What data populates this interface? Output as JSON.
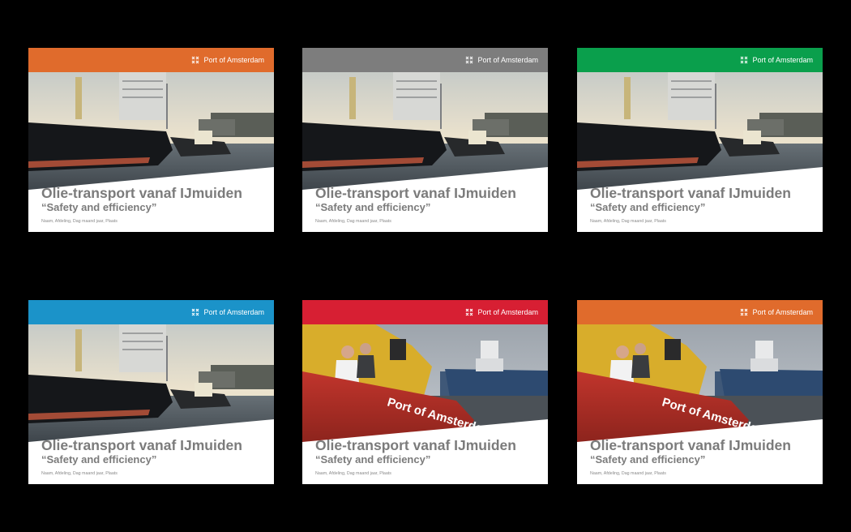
{
  "brand_name": "Port of Amsterdam",
  "logo_icon": "port-of-amsterdam-crosses-logo",
  "cards": [
    {
      "header_color": "#e06b2c",
      "photo": "tanker-with-tugboat",
      "title": "Olie-transport vanaf IJmuiden",
      "subtitle": "“Safety and efficiency”",
      "meta": "Naam, Afdeling, Dag maand jaar, Plaats"
    },
    {
      "header_color": "#7d7d7d",
      "photo": "tanker-with-tugboat",
      "title": "Olie-transport vanaf IJmuiden",
      "subtitle": "“Safety and efficiency”",
      "meta": "Naam, Afdeling, Dag maand jaar, Plaats"
    },
    {
      "header_color": "#0a9f4c",
      "photo": "tanker-with-tugboat",
      "title": "Olie-transport vanaf IJmuiden",
      "subtitle": "“Safety and efficiency”",
      "meta": "Naam, Afdeling, Dag maand jaar, Plaats"
    },
    {
      "header_color": "#1b93c9",
      "photo": "tanker-with-tugboat",
      "title": "Olie-transport vanaf IJmuiden",
      "subtitle": "“Safety and efficiency”",
      "meta": "Naam, Afdeling, Dag maand jaar, Plaats"
    },
    {
      "header_color": "#d71f33",
      "photo": "port-boat-with-crew",
      "title": "Olie-transport vanaf IJmuiden",
      "subtitle": "“Safety and efficiency”",
      "meta": "Naam, Afdeling, Dag maand jaar, Plaats"
    },
    {
      "header_color": "#e06b2c",
      "photo": "port-boat-with-crew",
      "title": "Olie-transport vanaf IJmuiden",
      "subtitle": "“Safety and efficiency”",
      "meta": "Naam, Afdeling, Dag maand jaar, Plaats"
    }
  ]
}
